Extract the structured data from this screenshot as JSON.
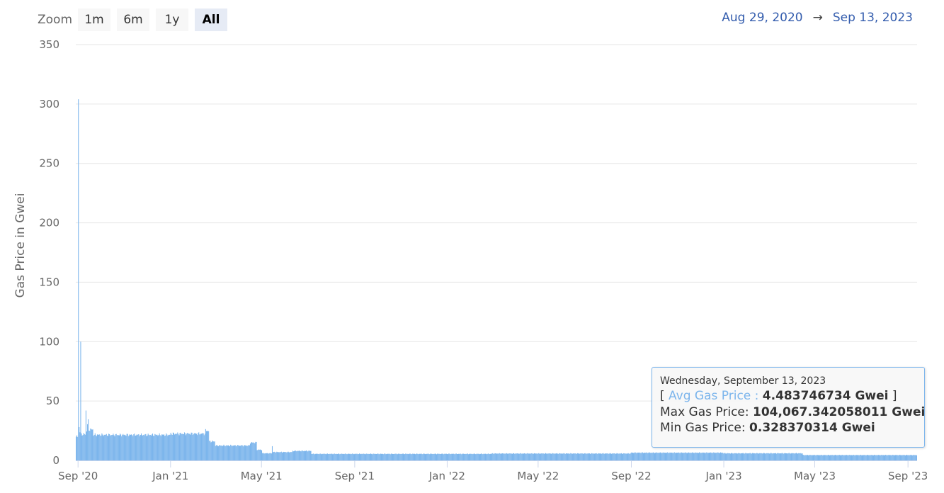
{
  "zoom": {
    "label": "Zoom",
    "buttons": [
      {
        "label": "1m",
        "active": false
      },
      {
        "label": "6m",
        "active": false
      },
      {
        "label": "1y",
        "active": false
      },
      {
        "label": "All",
        "active": true
      }
    ]
  },
  "range": {
    "from": "Aug 29, 2020",
    "arrow": "→",
    "to": "Sep 13, 2023"
  },
  "tooltip": {
    "date": "Wednesday, September 13, 2023",
    "open_bracket": "[",
    "avg_label": "Avg Gas Price :",
    "avg_value": "4.483746734 Gwei",
    "close_bracket": "]",
    "max_label": "Max Gas Price:",
    "max_value": "104,067.342058011 Gwei",
    "min_label": "Min Gas Price:",
    "min_value": "0.328370314 Gwei"
  },
  "chart_data": {
    "type": "bar",
    "ylabel": "Gas Price in Gwei",
    "ylim": [
      0,
      350
    ],
    "yticks": [
      0,
      50,
      100,
      150,
      200,
      250,
      300,
      350
    ],
    "xlim": [
      "2020-08-29",
      "2023-09-13"
    ],
    "xticks": [
      {
        "date": "2020-09-01",
        "label": "Sep '20"
      },
      {
        "date": "2021-01-01",
        "label": "Jan '21"
      },
      {
        "date": "2021-05-01",
        "label": "May '21"
      },
      {
        "date": "2021-09-01",
        "label": "Sep '21"
      },
      {
        "date": "2022-01-01",
        "label": "Jan '22"
      },
      {
        "date": "2022-05-01",
        "label": "May '22"
      },
      {
        "date": "2022-09-01",
        "label": "Sep '22"
      },
      {
        "date": "2023-01-01",
        "label": "Jan '23"
      },
      {
        "date": "2023-05-01",
        "label": "May '23"
      },
      {
        "date": "2023-09-01",
        "label": "Sep '23"
      }
    ],
    "grid": true,
    "bar_color": "#7cb5ec",
    "series": [
      {
        "values_by_period": [
          {
            "from": "2020-08-29",
            "to": "2020-08-31",
            "value": 20
          },
          {
            "from": "2020-09-01",
            "to": "2020-09-01",
            "value": 304
          },
          {
            "from": "2020-09-02",
            "to": "2020-09-02",
            "value": 28
          },
          {
            "from": "2020-09-03",
            "to": "2020-09-03",
            "value": 24
          },
          {
            "from": "2020-09-04",
            "to": "2020-09-04",
            "value": 100
          },
          {
            "from": "2020-09-05",
            "to": "2020-09-10",
            "value": 22
          },
          {
            "from": "2020-09-11",
            "to": "2020-09-11",
            "value": 42
          },
          {
            "from": "2020-09-12",
            "to": "2020-09-12",
            "value": 25
          },
          {
            "from": "2020-09-13",
            "to": "2020-09-13",
            "value": 30
          },
          {
            "from": "2020-09-14",
            "to": "2020-09-14",
            "value": 33
          },
          {
            "from": "2020-09-15",
            "to": "2020-09-20",
            "value": 26
          },
          {
            "from": "2020-09-21",
            "to": "2020-12-31",
            "value": 21.5
          },
          {
            "from": "2021-01-01",
            "to": "2021-02-15",
            "value": 22.5
          },
          {
            "from": "2021-02-16",
            "to": "2021-02-20",
            "value": 25
          },
          {
            "from": "2021-02-21",
            "to": "2021-02-28",
            "value": 16
          },
          {
            "from": "2021-03-01",
            "to": "2021-04-15",
            "value": 12.5
          },
          {
            "from": "2021-04-16",
            "to": "2021-04-24",
            "value": 15
          },
          {
            "from": "2021-04-25",
            "to": "2021-05-01",
            "value": 9
          },
          {
            "from": "2021-05-02",
            "to": "2021-05-14",
            "value": 6
          },
          {
            "from": "2021-05-15",
            "to": "2021-05-15",
            "value": 12
          },
          {
            "from": "2021-05-16",
            "to": "2021-06-10",
            "value": 7
          },
          {
            "from": "2021-06-11",
            "to": "2021-07-05",
            "value": 8
          },
          {
            "from": "2021-07-06",
            "to": "2022-02-28",
            "value": 5.5
          },
          {
            "from": "2022-03-01",
            "to": "2022-08-31",
            "value": 5.8
          },
          {
            "from": "2022-09-01",
            "to": "2022-12-31",
            "value": 6.5
          },
          {
            "from": "2023-01-01",
            "to": "2023-04-15",
            "value": 6
          },
          {
            "from": "2023-04-16",
            "to": "2023-09-13",
            "value": 4.5
          }
        ]
      }
    ]
  }
}
